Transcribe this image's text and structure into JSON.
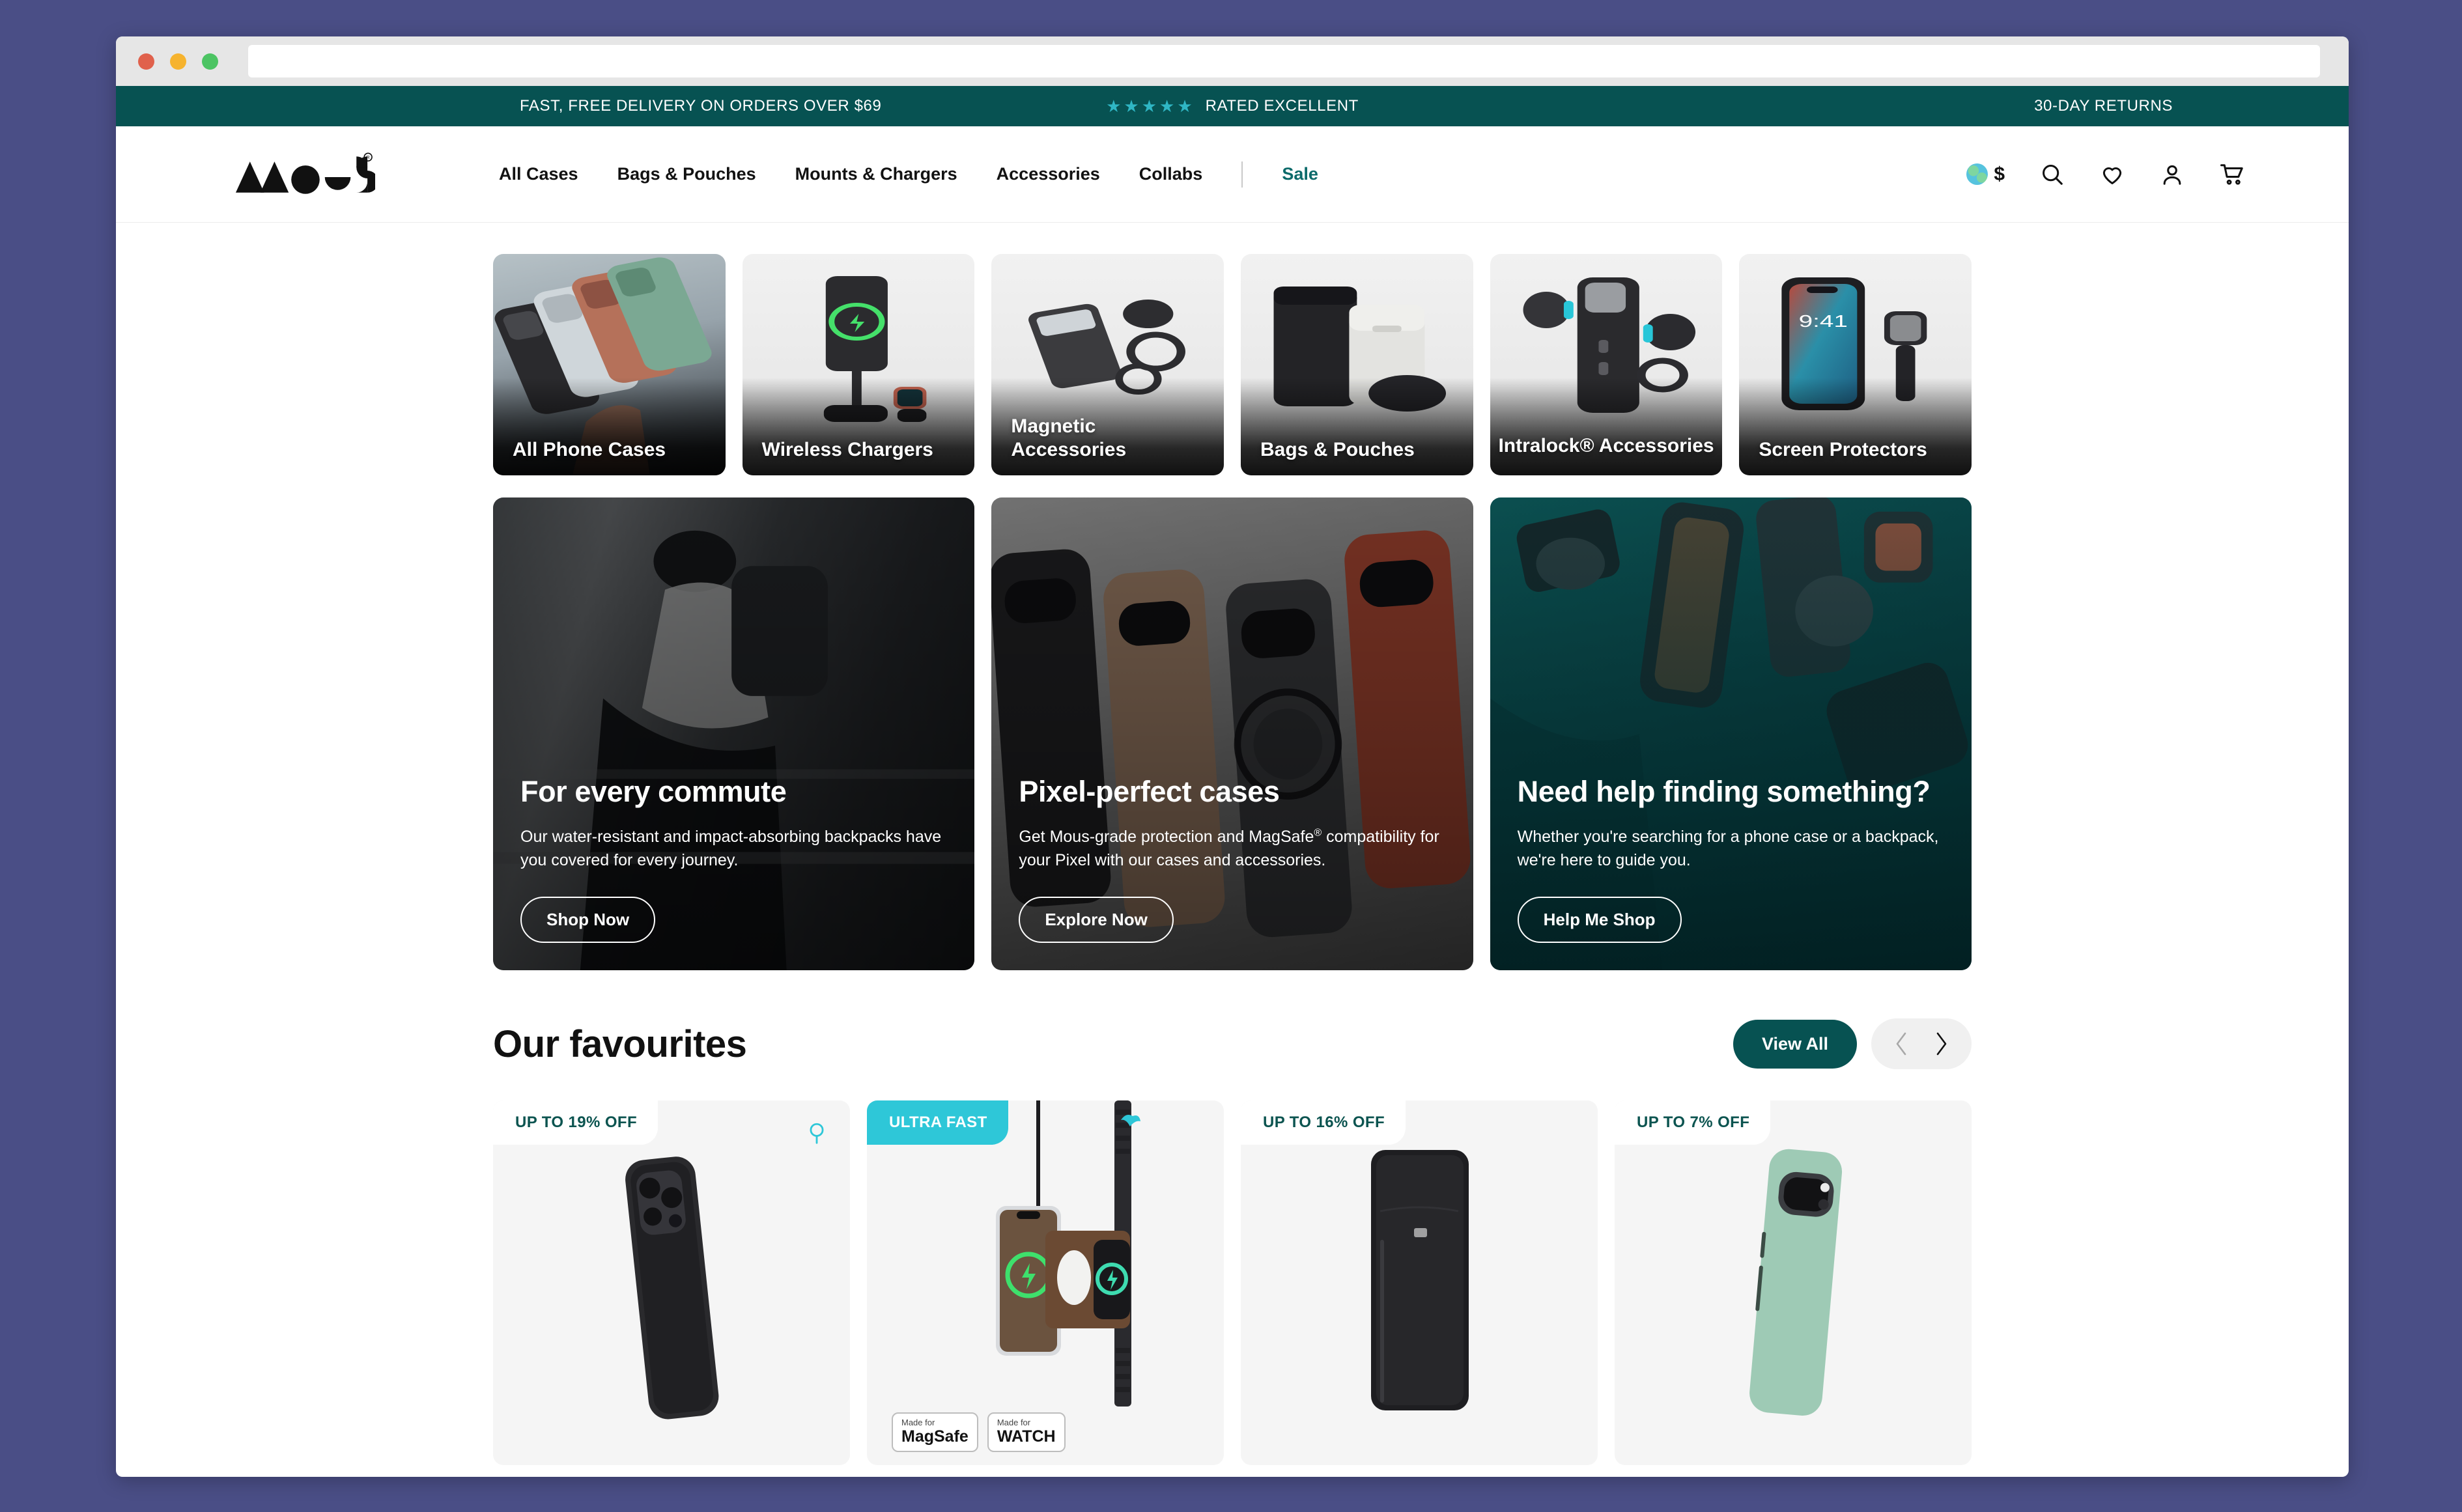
{
  "browser": {
    "url_value": "",
    "url_placeholder": "",
    "traffic_lights": [
      "close",
      "minimize",
      "zoom"
    ]
  },
  "announcement": {
    "left": "FAST, FREE DELIVERY ON ORDERS OVER $69",
    "stars": "★★★★★",
    "rating_text": "RATED EXCELLENT",
    "right": "30-DAY RETURNS",
    "bar_color": "#075252",
    "star_color": "#2fb6c4"
  },
  "header": {
    "logo_alt": "Mous",
    "nav": [
      {
        "label": "All Cases"
      },
      {
        "label": "Bags & Pouches"
      },
      {
        "label": "Mounts & Chargers"
      },
      {
        "label": "Accessories"
      },
      {
        "label": "Collabs"
      }
    ],
    "sale_label": "Sale",
    "sale_color": "#0c6a6a",
    "currency_symbol": "$",
    "icons": [
      "globe-icon",
      "search-icon",
      "wishlist-heart-icon",
      "account-icon",
      "cart-icon"
    ]
  },
  "categories": [
    {
      "label": "All Phone Cases",
      "centered": false
    },
    {
      "label": "Wireless Chargers",
      "centered": false
    },
    {
      "label": "Magnetic Accessories",
      "centered": false
    },
    {
      "label": "Bags & Pouches",
      "centered": false
    },
    {
      "label": "Intralock® Accessories",
      "centered": true
    },
    {
      "label": "Screen Protectors",
      "centered": false
    }
  ],
  "promos": [
    {
      "title": "For every commute",
      "body": "Our water-resistant and impact-absorbing backpacks have you covered for every journey.",
      "cta": "Shop Now"
    },
    {
      "title": "Pixel-perfect cases",
      "body_pre": "Get Mous-grade protection and MagSafe",
      "body_sup": "®",
      "body_post": " compatibility for your Pixel with our cases and accessories.",
      "cta": "Explore Now"
    },
    {
      "title": "Need help finding something?",
      "body": "Whether you're searching for a phone case or a backpack, we're here to guide you.",
      "cta": "Help Me Shop"
    }
  ],
  "favourites": {
    "title": "Our favourites",
    "view_all": "View All",
    "prev_icon": "chevron-left-icon",
    "next_icon": "chevron-right-icon",
    "accent_color": "#075252",
    "products": [
      {
        "badge": "UP TO 19% OFF",
        "badge_style": "light",
        "wishlist": true
      },
      {
        "badge": "ULTRA FAST",
        "badge_style": "fast",
        "wishlist": false,
        "certs": [
          {
            "top": "Made for",
            "main": "MagSafe"
          },
          {
            "top": "Made for",
            "main": "WATCH"
          }
        ]
      },
      {
        "badge": "UP TO 16% OFF",
        "badge_style": "light",
        "wishlist": false
      },
      {
        "badge": "UP TO 7% OFF",
        "badge_style": "light",
        "wishlist": false
      }
    ]
  }
}
